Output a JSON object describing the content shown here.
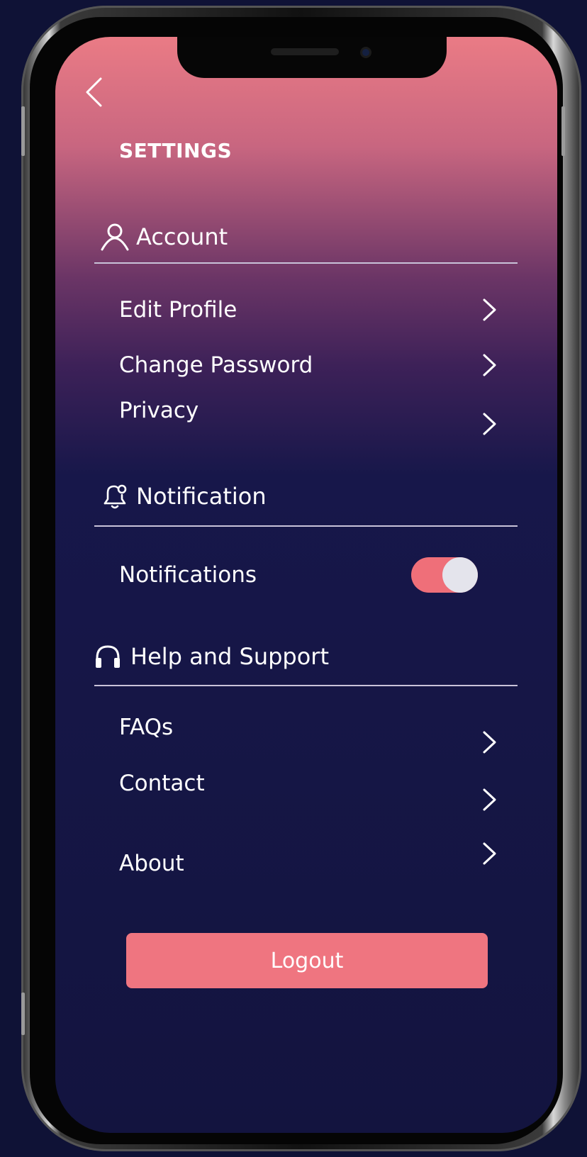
{
  "header": {
    "title": "SETTINGS",
    "back_icon": "chevron-left-icon"
  },
  "sections": {
    "account": {
      "label": "Account",
      "icon": "user-icon",
      "items": [
        {
          "label": "Edit Profile",
          "icon": "chevron-right-icon"
        },
        {
          "label": "Change Password",
          "icon": "chevron-right-icon"
        },
        {
          "label": "Privacy",
          "icon": "chevron-right-icon"
        }
      ]
    },
    "notification": {
      "label": "Notification",
      "icon": "bell-icon",
      "toggle": {
        "label": "Notifications",
        "on": true
      }
    },
    "help": {
      "label": "Help and Support",
      "icon": "headphones-icon",
      "items": [
        {
          "label": "FAQs",
          "icon": "chevron-right-icon"
        },
        {
          "label": "Contact",
          "icon": "chevron-right-icon"
        },
        {
          "label": "About",
          "icon": "chevron-right-icon"
        }
      ]
    }
  },
  "logout_label": "Logout",
  "colors": {
    "accent": "#ef7580",
    "background": "#13143f",
    "gradient_top": "#ea7b85",
    "text": "#ffffff"
  }
}
